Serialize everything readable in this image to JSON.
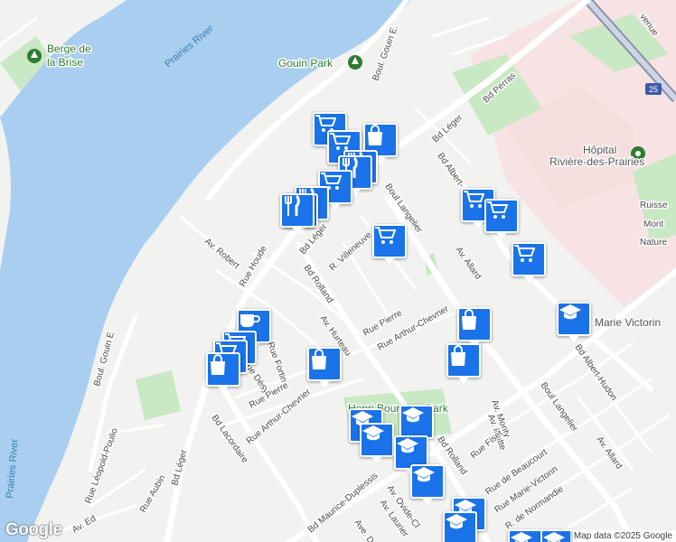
{
  "map": {
    "water_labels": [
      "Prairies River",
      "Prairies River"
    ],
    "park_labels": [
      "Berge de la Brise",
      "Gouin Park",
      "Henri Bourassa Park"
    ],
    "hospital_label": [
      "Hôpital",
      "Rivière-des-Prairies"
    ],
    "area_label": [
      "Ruisse",
      "Mont",
      "Nature"
    ],
    "highway_shield": "25",
    "street_labels": {
      "gouin_e_top": "Boul. Gouin E.",
      "gouin_e_left": "Boul. Gouin E",
      "perras": "Bd Perras",
      "leger_top": "Bd Léger",
      "leger_mid": "Bd Léger",
      "leger_bottom": "Bd Léger",
      "albert_hudon_top": "Bd Albert-",
      "albert_hudon_bottom": "Bd Albert-Hudon",
      "langelier_top": "Boul Langelier",
      "langelier_bottom": "Boul Langelier",
      "allard_top": "Av. Allard",
      "allard_bottom": "Av. Allard",
      "robert": "Av. Robert",
      "houde": "Rue Houde",
      "villeneuve": "R. Villeneuve",
      "rolland_top": "Bd Rolland",
      "rolland_bottom": "Bd Rolland",
      "hurteau": "Av. Hurteau",
      "fortin": "Rue Fortin",
      "desy": "Rue Désy",
      "pierre_left": "Rue Pierre",
      "pierre_right": "Rue Pierre",
      "chevrier_right": "Rue Arthur-Chevrier",
      "chevrier_left": "Rue Arthur-Chevrier",
      "lacordaire": "Bd Lacordaire",
      "leopold": "Rue Léopold-Poulio",
      "aubin": "Rue Aubin",
      "monty": "Av. Monty",
      "matte": "Av. Matte",
      "fiset": "Rue Fiset",
      "beaucourt": "Rue de Beaucourt",
      "marie_victorin": "Rue Marie-Victorin",
      "normandie": "R. de Normandie",
      "maurice_duplessis": "Bd Maurice-Duplessis",
      "ovide": "Av. Ovide-Cl",
      "laurier": "Av. Laurier",
      "av_ed": "Av. Ed",
      "av_des": "Ave. Dé",
      "marie_victorin_poi": "p Marie Victorin",
      "ave_top_right": "venue"
    },
    "markers": [
      {
        "icon": "cart-icon",
        "name": "cart-marker"
      },
      {
        "icon": "bag-icon",
        "name": "bag-marker"
      },
      {
        "icon": "cart-icon",
        "name": "cart-marker"
      },
      {
        "icon": "restaurant-icon",
        "name": "restaurant-marker"
      },
      {
        "icon": "restaurant-icon",
        "name": "restaurant-marker"
      },
      {
        "icon": "cart-icon",
        "name": "cart-marker"
      },
      {
        "icon": "restaurant-icon",
        "name": "restaurant-marker"
      },
      {
        "icon": "cart-icon",
        "name": "cart-marker"
      },
      {
        "icon": "cart-icon",
        "name": "cart-marker"
      },
      {
        "icon": "cart-icon",
        "name": "cart-marker"
      },
      {
        "icon": "cart-icon",
        "name": "cart-marker"
      },
      {
        "icon": "restaurant-icon",
        "name": "restaurant-marker"
      },
      {
        "icon": "cart-icon",
        "name": "cart-marker"
      },
      {
        "icon": "bag-icon",
        "name": "bag-marker"
      },
      {
        "icon": "bag-icon",
        "name": "bag-marker"
      },
      {
        "icon": "school-icon",
        "name": "school-marker"
      },
      {
        "icon": "coffee-icon",
        "name": "coffee-marker"
      },
      {
        "icon": "cart-icon",
        "name": "cart-marker"
      },
      {
        "icon": "cart-icon",
        "name": "cart-marker"
      },
      {
        "icon": "bag-icon",
        "name": "bag-marker"
      },
      {
        "icon": "bag-icon",
        "name": "bag-marker"
      },
      {
        "icon": "school-icon",
        "name": "school-marker"
      },
      {
        "icon": "school-icon",
        "name": "school-marker"
      },
      {
        "icon": "school-icon",
        "name": "school-marker"
      },
      {
        "icon": "school-icon",
        "name": "school-marker"
      },
      {
        "icon": "school-icon",
        "name": "school-marker"
      },
      {
        "icon": "school-icon",
        "name": "school-marker"
      },
      {
        "icon": "school-icon",
        "name": "school-marker"
      },
      {
        "icon": "school-icon",
        "name": "school-marker"
      },
      {
        "icon": "school-icon",
        "name": "school-marker"
      }
    ]
  },
  "footer": {
    "logo": "Google",
    "attribution": "Map data ©2025 Google"
  },
  "colors": {
    "water": "#a9cef0",
    "park": "#c9e8c4",
    "hospital_area": "#f5dede",
    "marker": "#1a73e8",
    "road": "#ffffff"
  }
}
